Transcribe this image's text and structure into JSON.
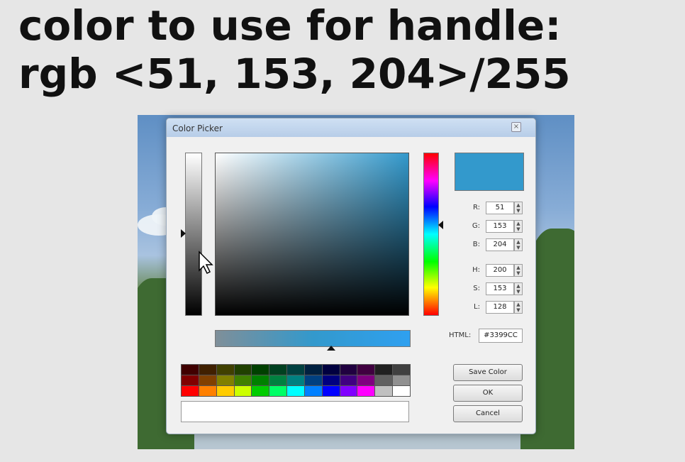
{
  "headline": {
    "line1": "color to use for handle:",
    "line2": "rgb <51, 153, 204>/255"
  },
  "dialog": {
    "title": "Color Picker",
    "close_glyph": "×",
    "preview_color": "#3399cc",
    "fields": [
      {
        "label": "R:",
        "value": "51"
      },
      {
        "label": "G:",
        "value": "153"
      },
      {
        "label": "B:",
        "value": "204"
      },
      {
        "label": "H:",
        "value": "200"
      },
      {
        "label": "S:",
        "value": "153"
      },
      {
        "label": "L:",
        "value": "128"
      }
    ],
    "html_label": "HTML:",
    "html_value": "#3399CC",
    "buttons": {
      "save": "Save Color",
      "ok": "OK",
      "cancel": "Cancel"
    },
    "palette": [
      "#400000",
      "#402000",
      "#404000",
      "#204000",
      "#004000",
      "#004020",
      "#004040",
      "#002040",
      "#000040",
      "#200040",
      "#400040",
      "#202020",
      "#404040",
      "#800000",
      "#804000",
      "#808000",
      "#408000",
      "#008000",
      "#008040",
      "#008080",
      "#004080",
      "#000080",
      "#400080",
      "#800080",
      "#606060",
      "#909090",
      "#ff0000",
      "#ff8000",
      "#ffcc00",
      "#ccff00",
      "#00cc00",
      "#00ff66",
      "#00ffff",
      "#0080ff",
      "#0000ff",
      "#8000ff",
      "#ff00ff",
      "#c0c0c0",
      "#ffffff"
    ],
    "icons": {
      "cursor": "arrow-cursor-icon"
    }
  }
}
